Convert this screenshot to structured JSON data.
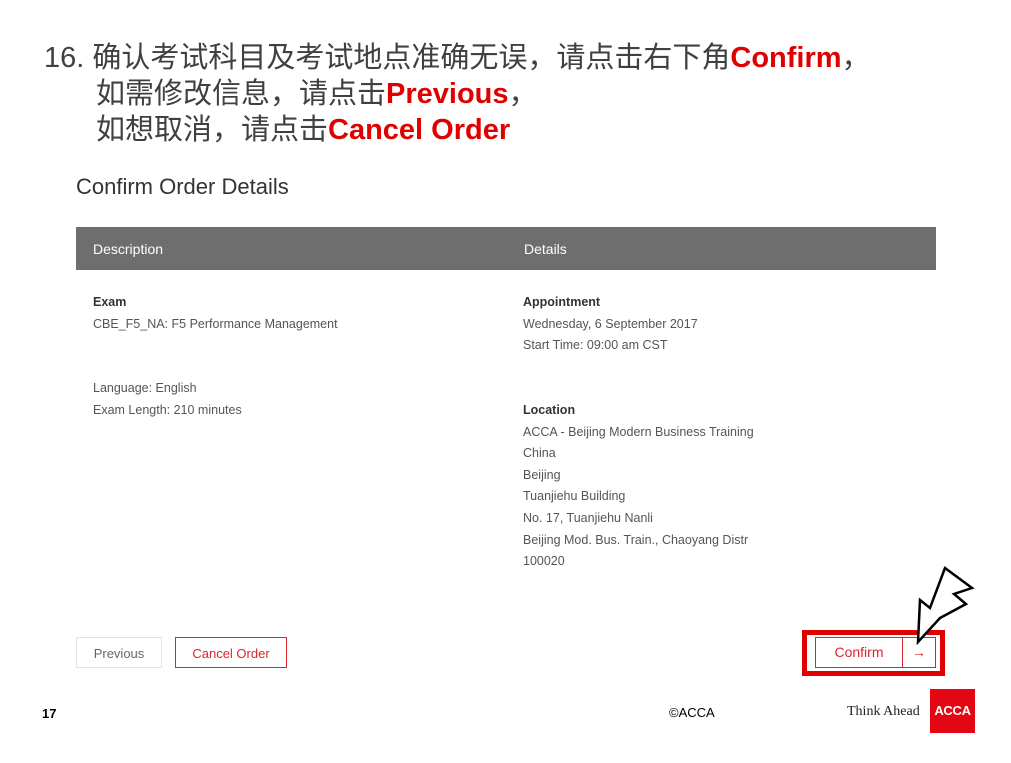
{
  "instructions": {
    "line1_prefix": "16. 确认考试科目及考试地点准确无误，请点击右下角",
    "line1_highlight": "Confirm",
    "line1_suffix": "，",
    "line2_prefix": "如需修改信息，请点击",
    "line2_highlight": "Previous",
    "line2_suffix": "，",
    "line3_prefix": "如想取消，请点击",
    "line3_highlight": "Cancel Order"
  },
  "page": {
    "title": "Confirm Order Details"
  },
  "table": {
    "headers": [
      "Description",
      "Details"
    ],
    "description": {
      "exam_label": "Exam",
      "exam_value": "CBE_F5_NA: F5 Performance Management",
      "language": "Language: English",
      "exam_length": "Exam Length: 210 minutes"
    },
    "details": {
      "appointment_label": "Appointment",
      "appointment_date": "Wednesday, 6 September 2017",
      "start_time": "Start Time: 09:00 am CST",
      "location_label": "Location",
      "location_lines": [
        "ACCA - Beijing Modern Business Training",
        "China",
        "Beijing",
        "Tuanjiehu Building",
        "No. 17, Tuanjiehu Nanli",
        "Beijing Mod. Bus. Train., Chaoyang Distr",
        "100020"
      ]
    }
  },
  "buttons": {
    "previous": "Previous",
    "cancel_order": "Cancel Order",
    "confirm": "Confirm",
    "confirm_arrow": "→"
  },
  "footer": {
    "page_number": "17",
    "copyright": "©ACCA",
    "tagline": "Think Ahead",
    "logo_text": "ACCA"
  },
  "colors": {
    "accent_red": "#e00000",
    "button_red": "#d9262e",
    "header_gray": "#6d6e6d",
    "logo_red": "#e30613"
  }
}
